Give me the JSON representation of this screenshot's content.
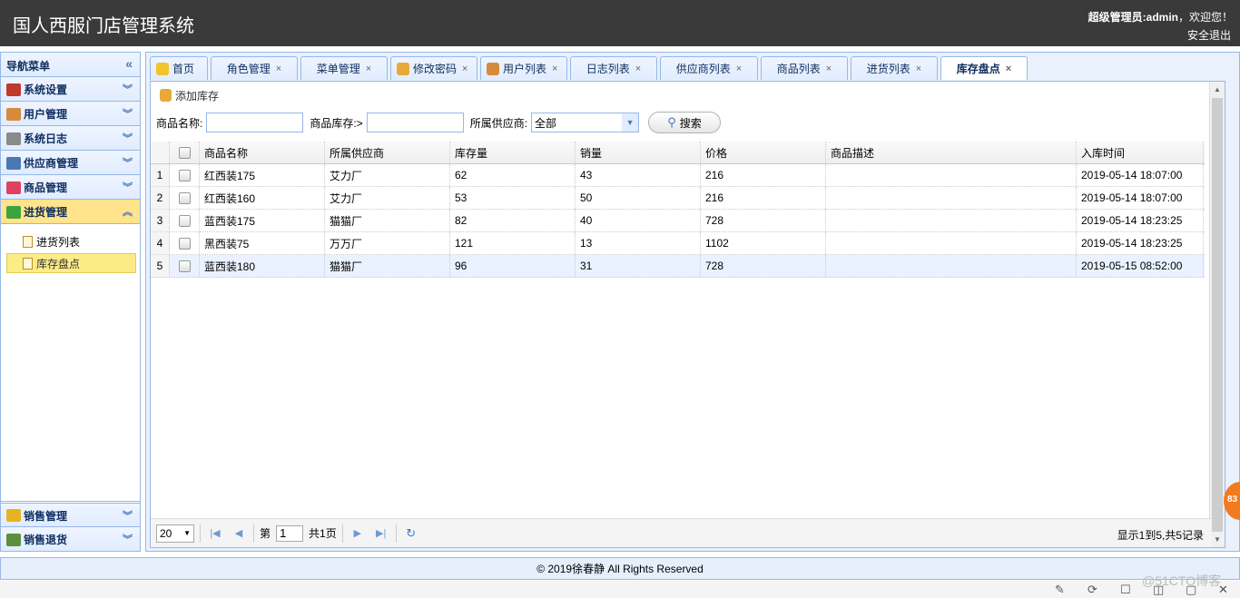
{
  "header": {
    "title": "国人西服门店管理系统",
    "welcome_prefix": "超级管理员:",
    "welcome_user": "admin",
    "welcome_suffix": "，欢迎您！",
    "logout": "安全退出"
  },
  "sidebar": {
    "title": "导航菜单",
    "sections": [
      {
        "label": "系统设置",
        "icon": "tools-icon",
        "color": "#c0392b"
      },
      {
        "label": "用户管理",
        "icon": "users-icon",
        "color": "#d68a3b"
      },
      {
        "label": "系统日志",
        "icon": "log-icon",
        "color": "#8a8a8a"
      },
      {
        "label": "供应商管理",
        "icon": "supplier-icon",
        "color": "#4a78b5"
      },
      {
        "label": "商品管理",
        "icon": "heart-icon",
        "color": "#e0415f"
      },
      {
        "label": "进货管理",
        "icon": "globe-icon",
        "color": "#3ca33c"
      }
    ],
    "subitems": [
      {
        "label": "进货列表"
      },
      {
        "label": "库存盘点"
      }
    ],
    "bottom_sections": [
      {
        "label": "销售管理",
        "icon": "sales-icon",
        "color": "#e6b422"
      },
      {
        "label": "销售退货",
        "icon": "return-icon",
        "color": "#5b8f3d"
      }
    ]
  },
  "tabs": [
    {
      "label": "首页",
      "closable": false,
      "icon": "bulb-icon",
      "color": "#f3c42a"
    },
    {
      "label": "角色管理",
      "closable": true
    },
    {
      "label": "菜单管理",
      "closable": true
    },
    {
      "label": "修改密码",
      "closable": true,
      "icon": "edit-icon",
      "color": "#e8a93a"
    },
    {
      "label": "用户列表",
      "closable": true,
      "icon": "users-icon",
      "color": "#d68a3b"
    },
    {
      "label": "日志列表",
      "closable": true
    },
    {
      "label": "供应商列表",
      "closable": true
    },
    {
      "label": "商品列表",
      "closable": true
    },
    {
      "label": "进货列表",
      "closable": true
    },
    {
      "label": "库存盘点",
      "closable": true
    }
  ],
  "toolbar": {
    "add_label": "添加库存"
  },
  "search": {
    "name_label": "商品名称:",
    "stock_label": "商品库存:>",
    "supplier_label": "所属供应商:",
    "supplier_value": "全部",
    "button": "搜索"
  },
  "grid": {
    "columns": [
      "商品名称",
      "所属供应商",
      "库存量",
      "销量",
      "价格",
      "商品描述",
      "入库时间"
    ],
    "rows": [
      {
        "n": "1",
        "name": "红西装175",
        "supplier": "艾力厂",
        "stock": "62",
        "sales": "43",
        "price": "216",
        "desc": "",
        "time": "2019-05-14 18:07:00"
      },
      {
        "n": "2",
        "name": "红西装160",
        "supplier": "艾力厂",
        "stock": "53",
        "sales": "50",
        "price": "216",
        "desc": "",
        "time": "2019-05-14 18:07:00"
      },
      {
        "n": "3",
        "name": "蓝西装175",
        "supplier": "猫猫厂",
        "stock": "82",
        "sales": "40",
        "price": "728",
        "desc": "",
        "time": "2019-05-14 18:23:25"
      },
      {
        "n": "4",
        "name": "黑西装75",
        "supplier": "万万厂",
        "stock": "121",
        "sales": "13",
        "price": "1102",
        "desc": "",
        "time": "2019-05-14 18:23:25"
      },
      {
        "n": "5",
        "name": "蓝西装180",
        "supplier": "猫猫厂",
        "stock": "96",
        "sales": "31",
        "price": "728",
        "desc": "",
        "time": "2019-05-15 08:52:00"
      }
    ]
  },
  "pager": {
    "page_size": "20",
    "page_prefix": "第",
    "page_value": "1",
    "page_total": "共1页",
    "info": "显示1到5,共5记录"
  },
  "footer": "© 2019徐春静 All Rights Reserved",
  "badge": "83",
  "watermark": "@51CTO博客"
}
